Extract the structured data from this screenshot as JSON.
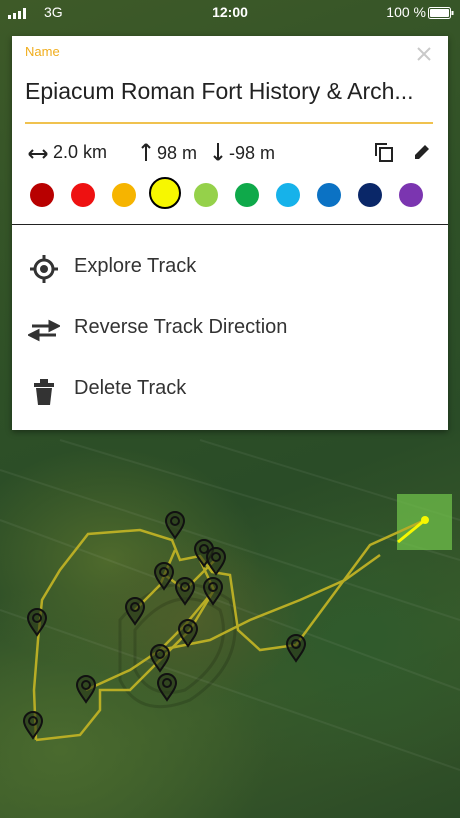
{
  "status_bar": {
    "carrier": "3G",
    "time": "12:00",
    "battery_pct": "100 %"
  },
  "panel": {
    "name_label": "Name",
    "name_value": "Epiacum Roman Fort History & Arch...",
    "stats": {
      "distance": "2.0 km",
      "ascent": "98 m",
      "descent": "-98 m"
    },
    "colors": [
      "#b80000",
      "#ee1111",
      "#f6b400",
      "#f7f700",
      "#95d14a",
      "#0fa94a",
      "#16b2ea",
      "#0b72c4",
      "#0a2768",
      "#7b35b0"
    ],
    "selected_color_index": 3,
    "menu": [
      {
        "label": "Explore Track",
        "icon": "explore-track-icon"
      },
      {
        "label": "Reverse Track Direction",
        "icon": "reverse-direction-icon"
      },
      {
        "label": "Delete Track",
        "icon": "trash-icon"
      }
    ]
  },
  "map": {
    "track_color": "#b8ad25",
    "selected_segment_color": "#f7f700",
    "marker_count": 16
  }
}
